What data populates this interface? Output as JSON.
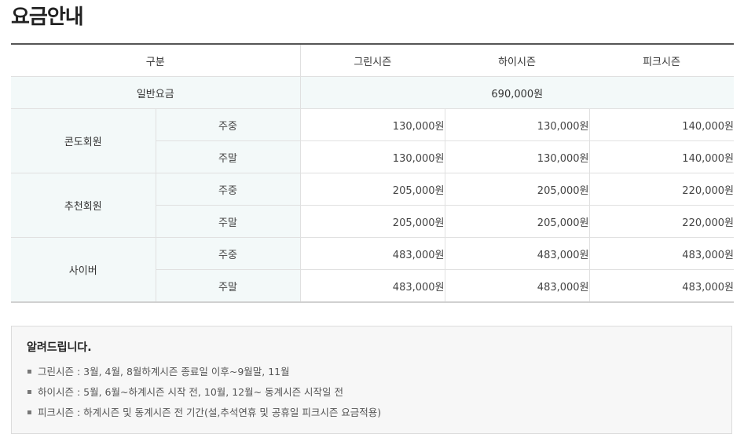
{
  "page_title": "요금안내",
  "table": {
    "headers": {
      "category": "구분",
      "green": "그린시즌",
      "high": "하이시즌",
      "peak": "피크시즌"
    },
    "general": {
      "label": "일반요금",
      "price": "690,000원"
    },
    "groups": [
      {
        "label": "콘도회원",
        "rows": [
          {
            "day": "주중",
            "green": "130,000원",
            "high": "130,000원",
            "peak": "140,000원"
          },
          {
            "day": "주말",
            "green": "130,000원",
            "high": "130,000원",
            "peak": "140,000원"
          }
        ]
      },
      {
        "label": "추천회원",
        "rows": [
          {
            "day": "주중",
            "green": "205,000원",
            "high": "205,000원",
            "peak": "220,000원"
          },
          {
            "day": "주말",
            "green": "205,000원",
            "high": "205,000원",
            "peak": "220,000원"
          }
        ]
      },
      {
        "label": "사이버",
        "rows": [
          {
            "day": "주중",
            "green": "483,000원",
            "high": "483,000원",
            "peak": "483,000원"
          },
          {
            "day": "주말",
            "green": "483,000원",
            "high": "483,000원",
            "peak": "483,000원"
          }
        ]
      }
    ]
  },
  "notice": {
    "title": "알려드립니다.",
    "bullet": "▪",
    "items": [
      "그린시즌 : 3월, 4월, 8월하계시즌 종료일 이후~9월말, 11월",
      "하이시즌 : 5월, 6월~하계시즌 시작 전, 10월, 12월~ 동계시즌 시작일 전",
      "피크시즌 : 하계시즌 및 동계시즌 전 기간(설,추석연휴 및 공휴일 피크시즌 요금적용)"
    ]
  }
}
